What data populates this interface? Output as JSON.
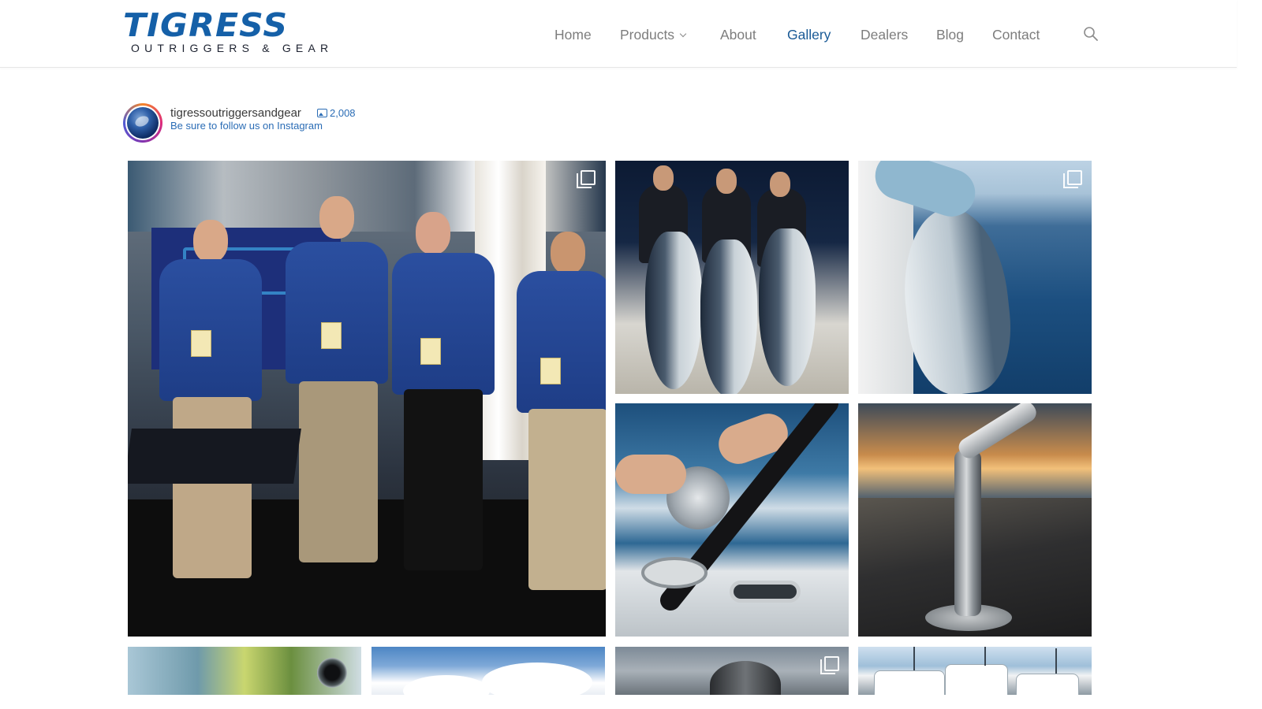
{
  "header": {
    "logo_main": "TIGRESS",
    "logo_sub": "OUTRIGGERS & GEAR",
    "nav": [
      {
        "label": "Home",
        "active": false
      },
      {
        "label": "Products",
        "active": false,
        "has_dropdown": true
      },
      {
        "label": "About",
        "active": false
      },
      {
        "label": "Gallery",
        "active": true
      },
      {
        "label": "Dealers",
        "active": false
      },
      {
        "label": "Blog",
        "active": false
      },
      {
        "label": "Contact",
        "active": false
      }
    ],
    "search_icon": "search-icon"
  },
  "instagram": {
    "username": "tigressoutriggersandgear",
    "post_count": "2,008",
    "follow_text": "Be sure to follow us on Instagram"
  },
  "gallery": {
    "tiles": [
      {
        "subject": "trade-show-team",
        "carousel": true
      },
      {
        "subject": "tuna-catch",
        "carousel": false
      },
      {
        "subject": "marlin-boatside",
        "carousel": true
      },
      {
        "subject": "rod-holder-ocean",
        "carousel": false
      },
      {
        "subject": "sunset-deck-holder",
        "carousel": false
      },
      {
        "subject": "mahi-closeup",
        "carousel": false
      },
      {
        "subject": "blue-sky",
        "carousel": false
      },
      {
        "subject": "outrigger-base",
        "carousel": true
      },
      {
        "subject": "marina-boats",
        "carousel": false
      }
    ]
  },
  "colors": {
    "brand_blue": "#1560a8",
    "nav_text": "#7d7d7d",
    "nav_active": "#1a5a96",
    "link_blue": "#2a6cb5"
  }
}
